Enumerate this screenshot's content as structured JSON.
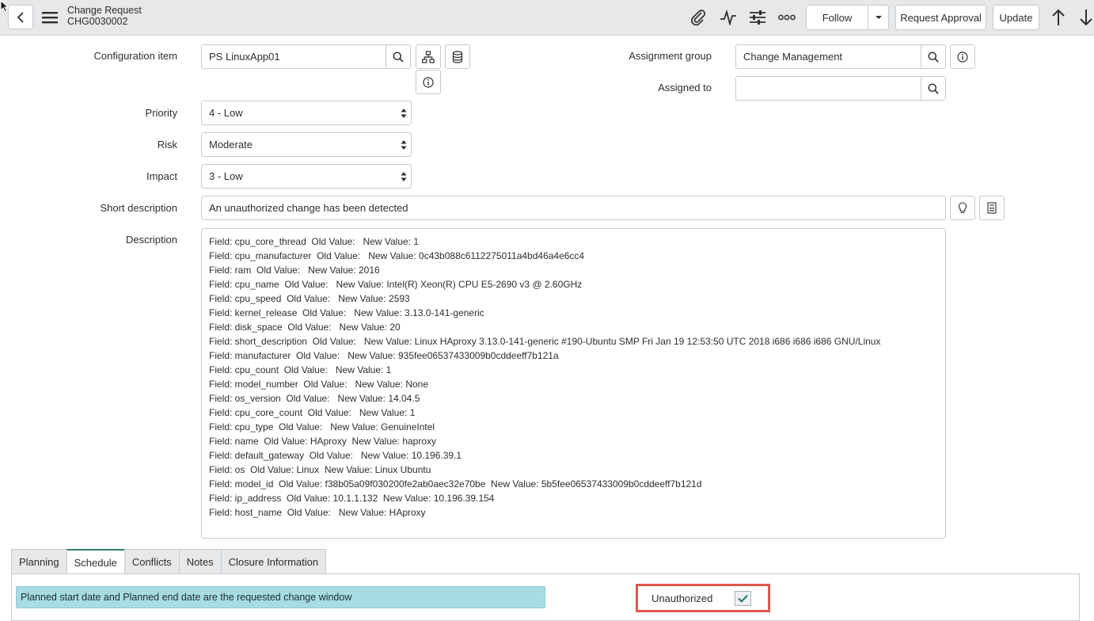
{
  "header": {
    "title": "Change Request",
    "number": "CHG0030002",
    "follow_label": "Follow",
    "request_approval_label": "Request Approval",
    "update_label": "Update"
  },
  "form": {
    "configuration_item": {
      "label": "Configuration item",
      "value": "PS LinuxApp01"
    },
    "assignment_group": {
      "label": "Assignment group",
      "value": "Change Management"
    },
    "assigned_to": {
      "label": "Assigned to",
      "value": ""
    },
    "priority": {
      "label": "Priority",
      "value": "4 - Low"
    },
    "risk": {
      "label": "Risk",
      "value": "Moderate"
    },
    "impact": {
      "label": "Impact",
      "value": "3 - Low"
    },
    "short_description": {
      "label": "Short description",
      "value": "An unauthorized change has been detected"
    },
    "description": {
      "label": "Description",
      "lines": [
        "Field: cpu_core_thread  Old Value:   New Value: 1",
        "Field: cpu_manufacturer  Old Value:   New Value: 0c43b088c6112275011a4bd46a4e6cc4",
        "Field: ram  Old Value:   New Value: 2016",
        "Field: cpu_name  Old Value:   New Value: Intel(R) Xeon(R) CPU E5-2690 v3 @ 2.60GHz",
        "Field: cpu_speed  Old Value:   New Value: 2593",
        "Field: kernel_release  Old Value:   New Value: 3.13.0-141-generic",
        "Field: disk_space  Old Value:   New Value: 20",
        "Field: short_description  Old Value:   New Value: Linux HAproxy 3.13.0-141-generic #190-Ubuntu SMP Fri Jan 19 12:53:50 UTC 2018 i686 i686 i686 GNU/Linux",
        "Field: manufacturer  Old Value:   New Value: 935fee06537433009b0cddeeff7b121a",
        "Field: cpu_count  Old Value:   New Value: 1",
        "Field: model_number  Old Value:   New Value: None",
        "Field: os_version  Old Value:   New Value: 14.04.5",
        "Field: cpu_core_count  Old Value:   New Value: 1",
        "Field: cpu_type  Old Value:   New Value: GenuineIntel",
        "Field: name  Old Value: HAproxy  New Value: haproxy",
        "Field: default_gateway  Old Value:   New Value: 10.196.39.1",
        "Field: os  Old Value: Linux  New Value: Linux Ubuntu",
        "Field: model_id  Old Value: f38b05a09f030200fe2ab0aec32e70be  New Value: 5b5fee06537433009b0cddeeff7b121d",
        "Field: ip_address  Old Value: 10.1.1.132  New Value: 10.196.39.154",
        "Field: host_name  Old Value:   New Value: HAproxy"
      ]
    }
  },
  "tabs": [
    "Planning",
    "Schedule",
    "Conflicts",
    "Notes",
    "Closure Information"
  ],
  "active_tab": "Schedule",
  "schedule": {
    "info_message": "Planned start date and Planned end date are the requested change window",
    "unauthorized_label": "Unauthorized",
    "unauthorized_checked": true
  },
  "colors": {
    "accent": "#2e7a6e",
    "info_bg": "#a8dce3",
    "highlight": "#e0574e",
    "header_bg": "#e6e8ea"
  }
}
